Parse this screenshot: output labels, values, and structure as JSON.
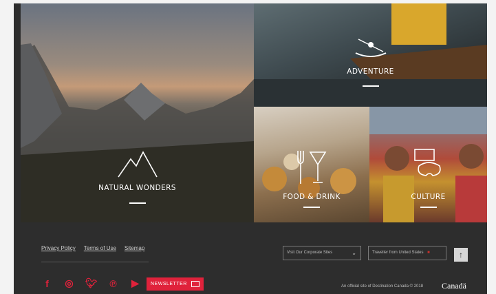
{
  "tiles": {
    "natural": {
      "label": "NATURAL WONDERS",
      "icon": "mountain-icon"
    },
    "adventure": {
      "label": "ADVENTURE",
      "icon": "kayak-icon"
    },
    "food": {
      "label": "FOOD & DRINK",
      "icon": "fork-glass-icon"
    },
    "culture": {
      "label": "CULTURE",
      "icon": "palette-icon"
    }
  },
  "footer": {
    "links": [
      "Privacy Policy",
      "Terms of Use",
      "Sitemap"
    ],
    "corporate_select": "Visit Our Corporate Sites",
    "traveller_select": "Traveller from United States",
    "newsletter_label": "NEWSLETTER",
    "official_text": "An official site of Destination Canada © 2018",
    "wordmark": "Canadä",
    "social": [
      "facebook-icon",
      "instagram-icon",
      "twitter-icon",
      "pinterest-icon",
      "youtube-icon"
    ]
  },
  "colors": {
    "accent": "#e0223b",
    "background": "#2d2d2d"
  }
}
